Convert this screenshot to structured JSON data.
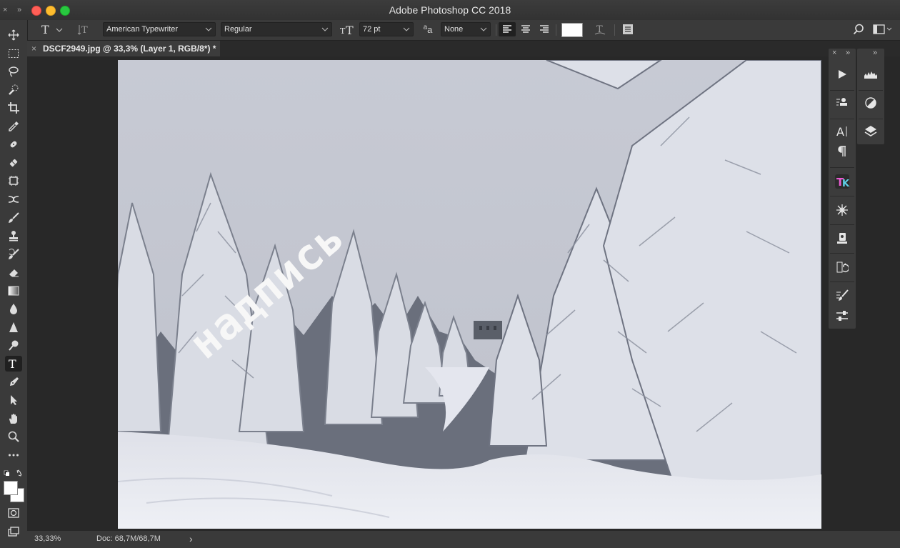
{
  "window": {
    "title": "Adobe Photoshop CC 2018",
    "corner_left": "×",
    "corner_right": "»"
  },
  "options_bar": {
    "font_family": "American Typewriter",
    "font_style": "Regular",
    "font_size": "72 pt",
    "aa_label": "a",
    "anti_alias": "None",
    "text_color": "#ffffff"
  },
  "document_tab": {
    "close": "×",
    "label": "DSCF2949.jpg @ 33,3% (Layer 1, RGB/8*) *"
  },
  "canvas": {
    "overlay_text": "надпись"
  },
  "status_bar": {
    "zoom": "33,33%",
    "doc_info": "Doc: 68,7M/68,7M",
    "arrow": "›"
  },
  "panels": {
    "close": "×",
    "collapse": "»"
  },
  "icons": {
    "move": "move-icon",
    "marquee": "rectangular-marquee-icon",
    "lasso": "lasso-icon",
    "quick_select": "quick-selection-icon",
    "crop": "crop-icon",
    "eyedropper": "eyedropper-icon",
    "healing": "healing-brush-icon",
    "brush": "brush-icon",
    "stamp": "clone-stamp-icon",
    "history_brush": "history-brush-icon",
    "eraser": "eraser-icon",
    "gradient": "gradient-icon",
    "blur": "blur-icon",
    "dodge": "dodge-icon",
    "pen": "pen-icon",
    "type": "type-icon",
    "path_select": "path-selection-icon",
    "hand": "hand-icon",
    "zoom": "zoom-icon",
    "more": "more-tools-icon"
  },
  "colors": {
    "foreground": "#ffffff",
    "background": "#ffffff",
    "sky": "#c9ccd6",
    "snow": "#eef0f5"
  }
}
